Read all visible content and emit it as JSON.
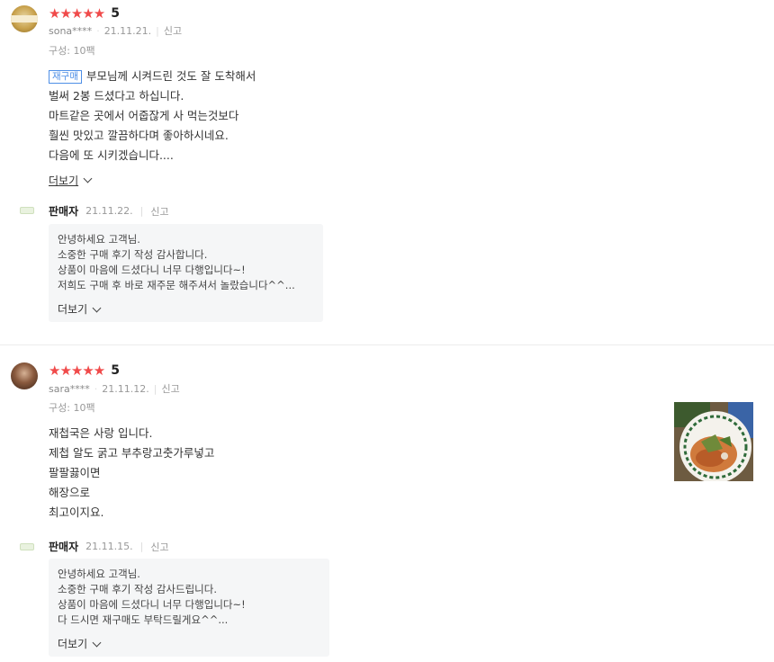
{
  "reviews": [
    {
      "stars": "★★★★★",
      "score": "5",
      "user": "sona****",
      "date": "21.11.21.",
      "report": "신고",
      "option": "구성: 10팩",
      "badge": "재구매",
      "lines": [
        "부모님께 시켜드린 것도 잘 도착해서",
        "벌써 2봉 드셨다고 하십니다.",
        "마트같은 곳에서 어줍잖게 사 먹는것보다",
        "훨씬 맛있고 깔끔하다며 좋아하시네요.",
        "다음에 또 시키겠습니다...."
      ],
      "more": "더보기",
      "seller": {
        "name": "판매자",
        "date": "21.11.22.",
        "report": "신고",
        "lines": [
          "안녕하세요 고객님.",
          "소중한 구매 후기 작성 감사합니다.",
          "상품이 마음에 드셨다니 너무 다행입니다~!",
          "저희도 구매 후 바로 재주문 해주셔서 놀랐습니다^^..."
        ],
        "more": "더보기"
      }
    },
    {
      "stars": "★★★★★",
      "score": "5",
      "user": "sara****",
      "date": "21.11.12.",
      "report": "신고",
      "option": "구성: 10팩",
      "lines": [
        "재첩국은 사랑 입니다.",
        "제첩 알도 굵고 부추랑고춧가루넣고",
        "팔팔끓이면",
        "해장으로",
        "최고이지요."
      ],
      "seller": {
        "name": "판매자",
        "date": "21.11.15.",
        "report": "신고",
        "lines": [
          "안녕하세요 고객님.",
          "소중한 구매 후기 작성 감사드립니다.",
          "상품이 마음에 드셨다니 너무 다행입니다~!",
          "다 드시면 재구매도 부탁드릴게요^^..."
        ],
        "more": "더보기"
      }
    }
  ],
  "colors": {
    "star": "#f04a4a",
    "badge": "#4e8fe6",
    "reply_bg": "#f5f6f7"
  }
}
